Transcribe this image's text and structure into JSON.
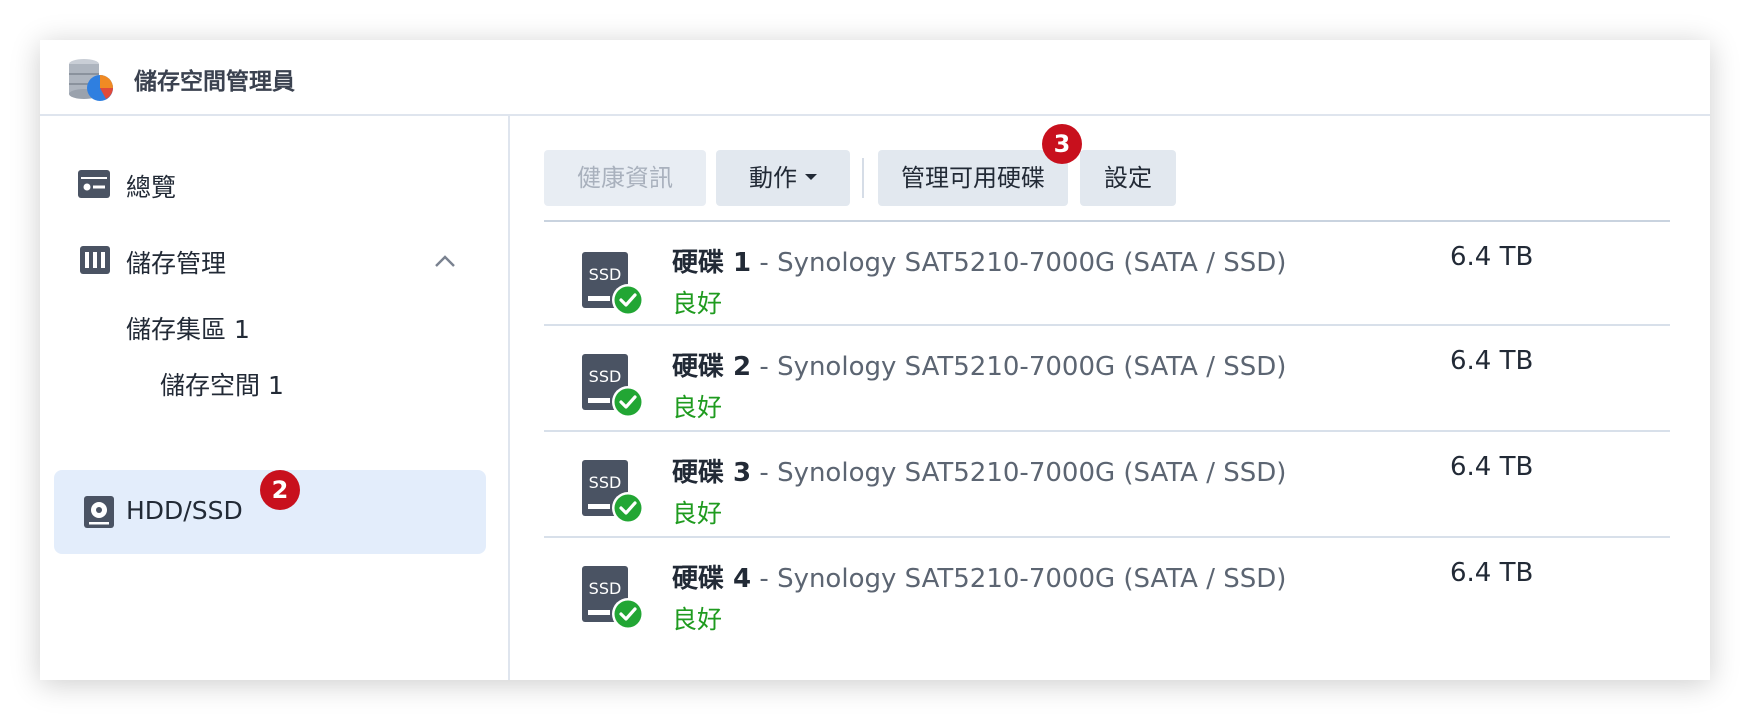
{
  "app": {
    "title": "儲存空間管理員",
    "icon": "storage-manager-icon"
  },
  "sidebar": {
    "overview": {
      "label": "總覽",
      "icon": "overview-card-icon"
    },
    "storage": {
      "label": "儲存管理",
      "icon": "storage-rack-icon",
      "expanded": true
    },
    "pool": {
      "label": "儲存集區 1"
    },
    "volume": {
      "label": "儲存空間 1"
    },
    "hdd": {
      "label": "HDD/SSD",
      "icon": "hdd-icon",
      "selected": true
    }
  },
  "badges": {
    "hdd": "2",
    "manage": "3"
  },
  "toolbar": {
    "health_label": "健康資訊",
    "action_label": "動作",
    "manage_label": "管理可用硬碟",
    "settings_label": "設定"
  },
  "disks": [
    {
      "label": "硬碟 1",
      "model": " - Synology SAT5210-7000G (SATA / SSD)",
      "status": "良好",
      "size": "6.4 TB",
      "icon": "ssd-icon"
    },
    {
      "label": "硬碟 2",
      "model": " - Synology SAT5210-7000G (SATA / SSD)",
      "status": "良好",
      "size": "6.4 TB",
      "icon": "ssd-icon"
    },
    {
      "label": "硬碟 3",
      "model": " - Synology SAT5210-7000G (SATA / SSD)",
      "status": "良好",
      "size": "6.4 TB",
      "icon": "ssd-icon"
    },
    {
      "label": "硬碟 4",
      "model": " - Synology SAT5210-7000G (SATA / SSD)",
      "status": "良好",
      "size": "6.4 TB",
      "icon": "ssd-icon"
    }
  ],
  "ssd_icon_text": "SSD",
  "colors": {
    "status_good": "#1f9b1f",
    "badge": "#c8101d",
    "selected_bg": "#e3edfb",
    "check": "#22a634"
  }
}
